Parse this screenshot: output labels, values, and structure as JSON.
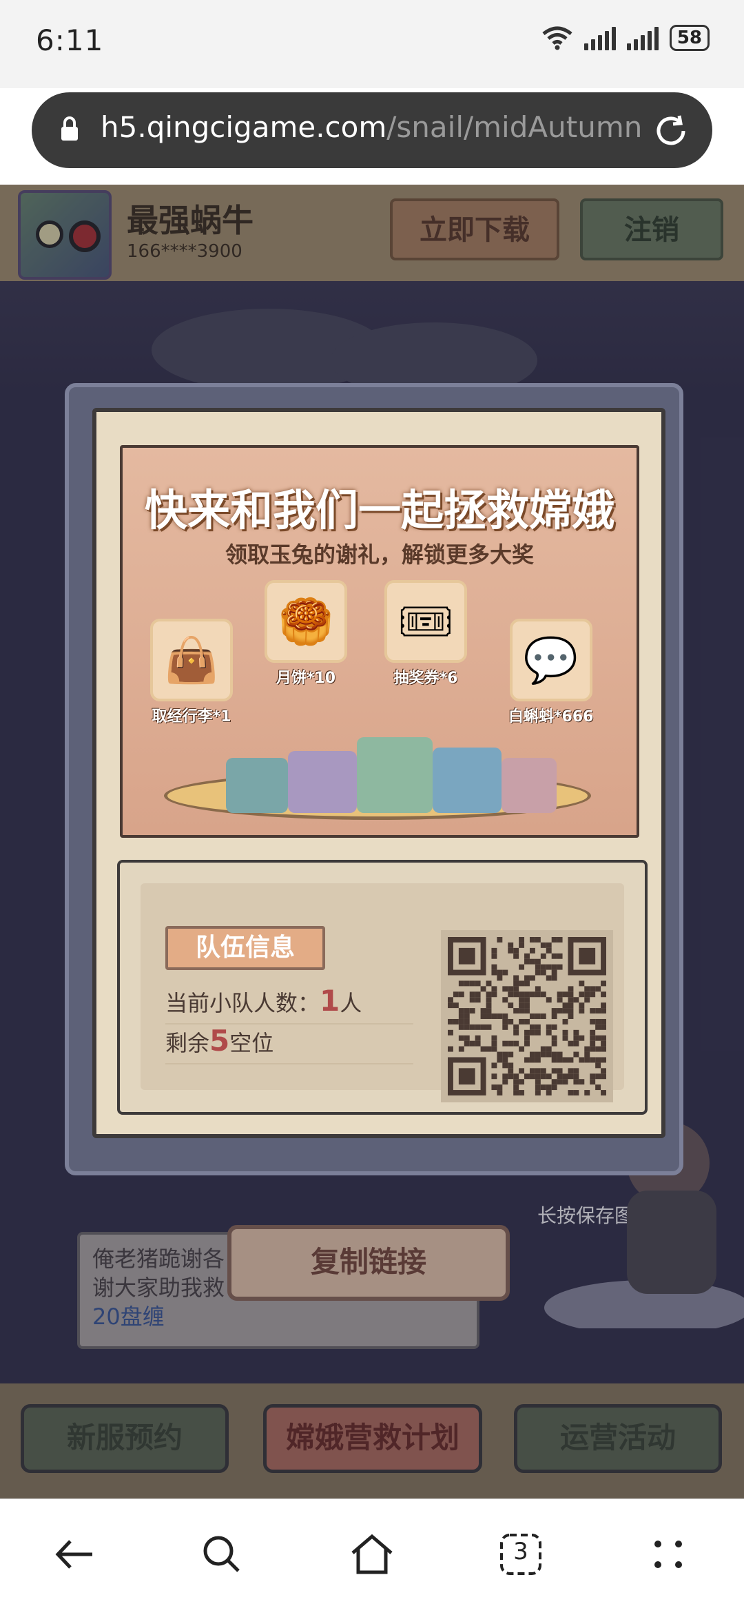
{
  "status_bar": {
    "time": "6:11",
    "battery": "58"
  },
  "browser": {
    "url_domain": "h5.qingcigame.com",
    "url_path": "/snail/midAutumn",
    "tabs_count": "3"
  },
  "header": {
    "game_name": "最强蜗牛",
    "phone": "166****3900",
    "download_label": "立即下载",
    "logout_label": "注销"
  },
  "banner": {
    "title": "快来和我们一起拯救嫦娥",
    "subtitle": "领取玉兔的谢礼，解锁更多大奖",
    "rewards": [
      {
        "label": "取经行李*1",
        "icon": "bag-icon"
      },
      {
        "label": "月饼*10",
        "icon": "mooncake-icon"
      },
      {
        "label": "抽奖券*6",
        "icon": "ticket-icon"
      },
      {
        "label": "白蝌蚪*666",
        "icon": "tadpole-icon"
      }
    ]
  },
  "team": {
    "tag": "队伍信息",
    "count_prefix": "当前小队人数：",
    "count_value": "1",
    "count_suffix": "人",
    "remaining_prefix": "剩余",
    "remaining_value": "5",
    "remaining_suffix": "空位"
  },
  "save_hint": "长按保存图片",
  "copy_link_label": "复制链接",
  "chat": {
    "line1": "俺老猪跪谢各",
    "line2": "谢大家助我救",
    "link": "20盘缠"
  },
  "bottom_nav": {
    "reserve": "新服预约",
    "plan": "嫦娥营救计划",
    "events": "运营活动"
  },
  "colors": {
    "accent": "#b6705e",
    "title_stroke": "#7b4a2a",
    "highlight_number": "#b04a4a"
  }
}
